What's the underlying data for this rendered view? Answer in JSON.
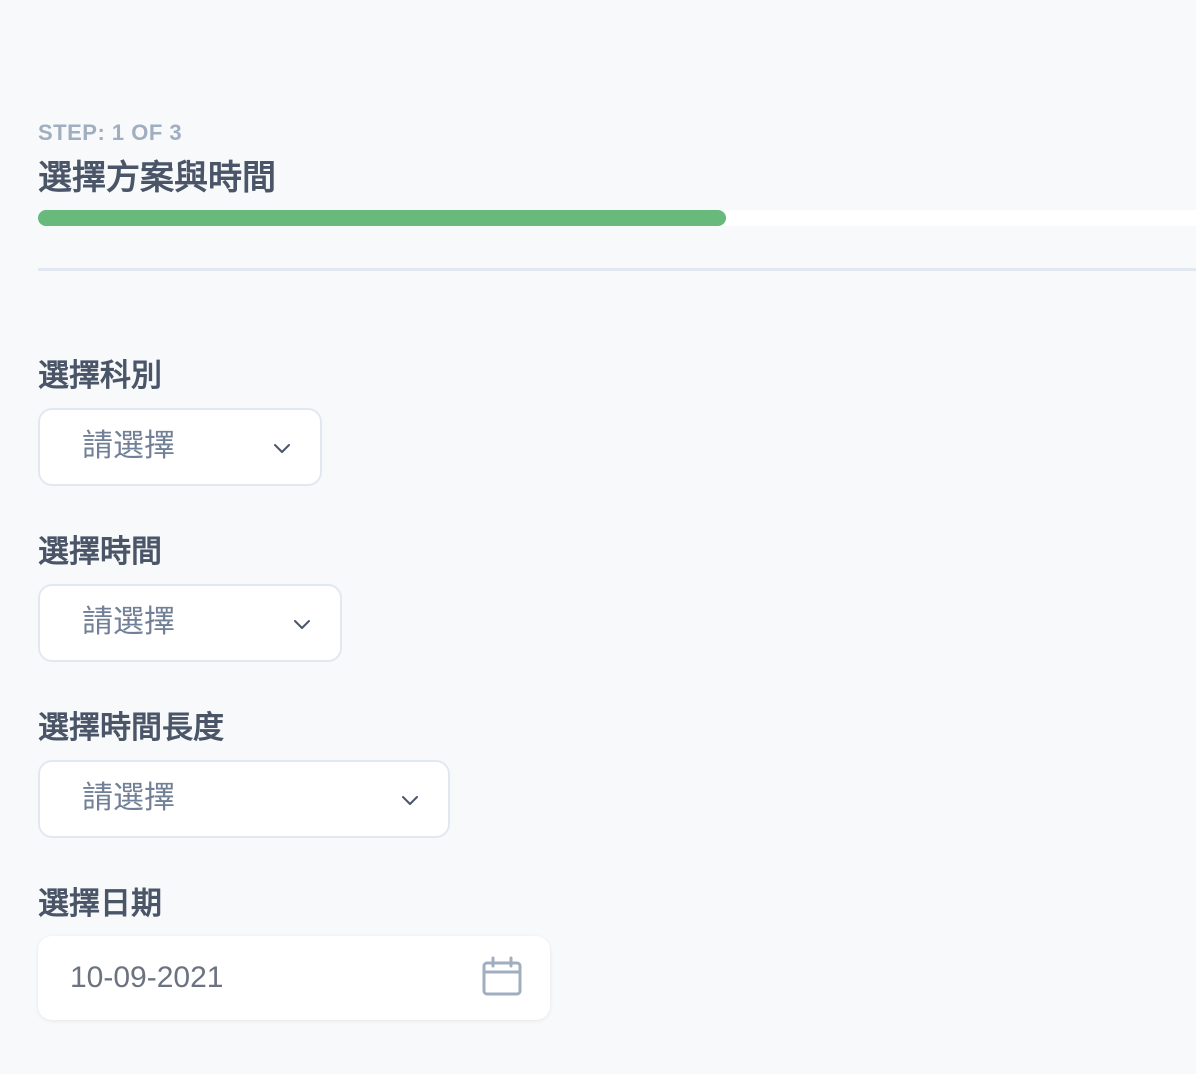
{
  "header": {
    "step_label": "STEP: 1 OF 3",
    "title": "選擇方案與時間",
    "progress_fraction": 0.594,
    "progress_color": "#68b97c"
  },
  "fields": {
    "department": {
      "label": "選擇科別",
      "value": "請選擇",
      "icon": "chevron-down-icon"
    },
    "time": {
      "label": "選擇時間",
      "value": "請選擇",
      "icon": "chevron-down-icon"
    },
    "duration": {
      "label": "選擇時間長度",
      "value": "請選擇",
      "icon": "chevron-down-icon"
    },
    "date": {
      "label": "選擇日期",
      "value": "10-09-2021",
      "icon": "calendar-icon"
    }
  }
}
